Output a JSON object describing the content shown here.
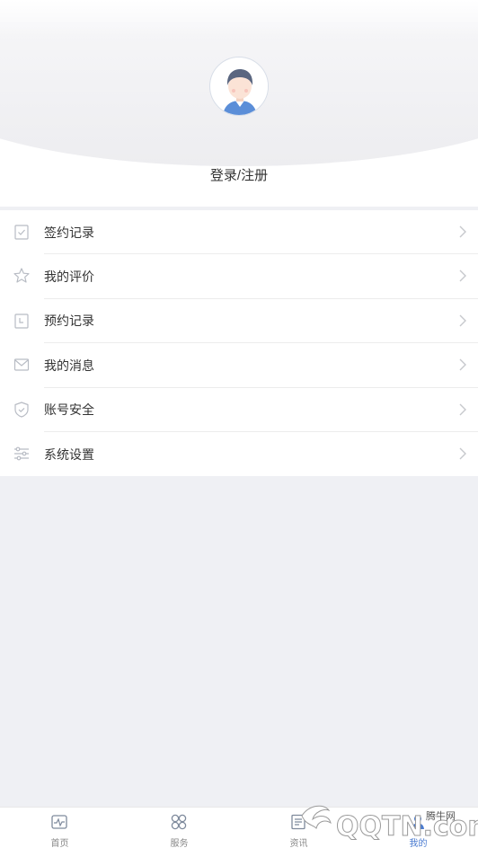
{
  "profile": {
    "login_label": "登录/注册"
  },
  "menu": {
    "items": [
      {
        "label": "签约记录",
        "icon": "signed-record-icon"
      },
      {
        "label": "我的评价",
        "icon": "star-icon"
      },
      {
        "label": "预约记录",
        "icon": "calendar-icon"
      },
      {
        "label": "我的消息",
        "icon": "mail-icon"
      },
      {
        "label": "账号安全",
        "icon": "shield-icon"
      },
      {
        "label": "系统设置",
        "icon": "sliders-icon"
      }
    ]
  },
  "tabbar": {
    "tabs": [
      {
        "label": "首页",
        "icon": "home-pulse-icon"
      },
      {
        "label": "服务",
        "icon": "services-icon"
      },
      {
        "label": "资讯",
        "icon": "news-icon"
      },
      {
        "label": "我的",
        "icon": "person-icon",
        "active": true
      }
    ]
  },
  "watermark": {
    "brand": "QQTN.com",
    "site": "腾牛网"
  },
  "colors": {
    "accent": "#4a7bd0",
    "text": "#333333",
    "muted": "#888888",
    "background": "#eff0f4"
  }
}
